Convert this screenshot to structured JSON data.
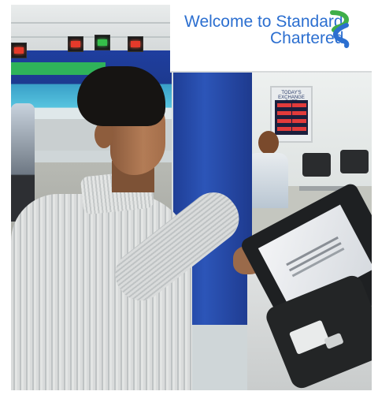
{
  "scene": {
    "description_role": "photo",
    "sign": {
      "line1": "Welcome to",
      "line2": "Standard",
      "line3": "Chartered"
    },
    "rate_board": {
      "title": "TODAY'S EXCHANGE RATE"
    },
    "colors": {
      "brand_blue": "#2c6fd0",
      "brand_green": "#3fae49",
      "pillar": "#2a4fb0"
    }
  }
}
